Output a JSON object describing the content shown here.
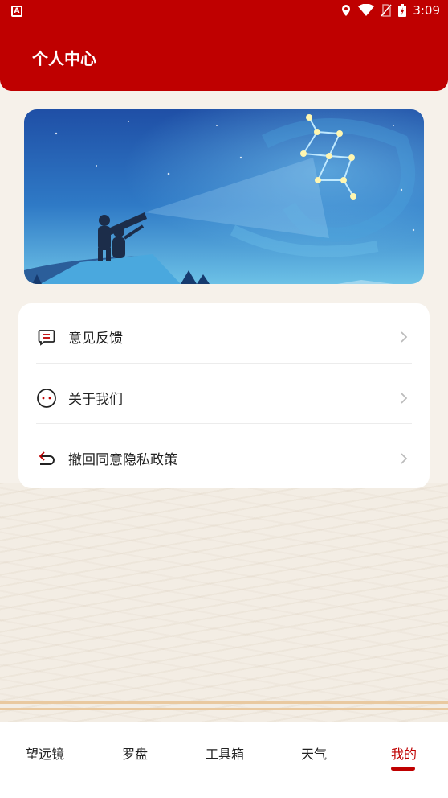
{
  "status_bar": {
    "time": "3:09",
    "left_icon": "a-badge-icon",
    "icons": [
      "location-icon",
      "wifi-icon",
      "no-sim-icon",
      "battery-charging-icon"
    ]
  },
  "header": {
    "title": "个人中心",
    "bg_color": "#bf0000"
  },
  "banner": {
    "image": "stargazing-telescope-illustration"
  },
  "menu": {
    "items": [
      {
        "label": "意见反馈",
        "icon": "feedback-icon"
      },
      {
        "label": "关于我们",
        "icon": "about-face-icon"
      },
      {
        "label": "撤回同意隐私政策",
        "icon": "undo-icon"
      }
    ]
  },
  "bottom_nav": {
    "items": [
      {
        "label": "望远镜"
      },
      {
        "label": "罗盘"
      },
      {
        "label": "工具箱"
      },
      {
        "label": "天气"
      },
      {
        "label": "我的"
      }
    ],
    "active_index": 4,
    "accent_color": "#bf0000"
  }
}
